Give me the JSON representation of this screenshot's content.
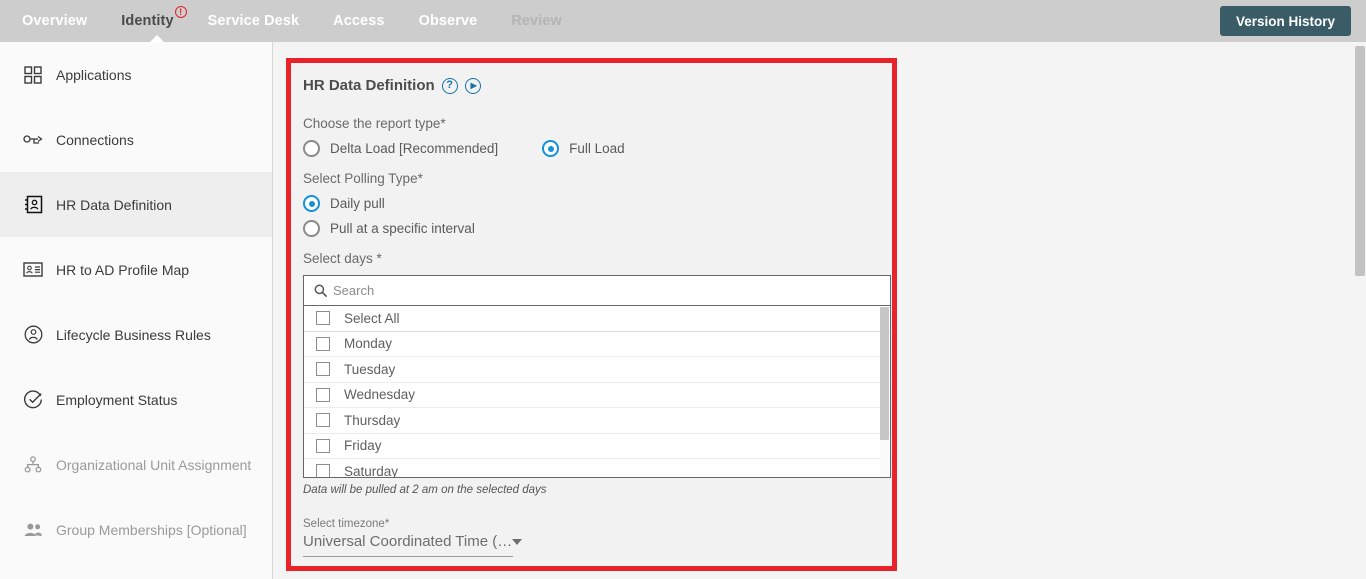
{
  "topnav": {
    "items": [
      {
        "label": "Overview",
        "state": "normal"
      },
      {
        "label": "Identity",
        "state": "active",
        "badge": "!"
      },
      {
        "label": "Service Desk",
        "state": "normal"
      },
      {
        "label": "Access",
        "state": "normal"
      },
      {
        "label": "Observe",
        "state": "normal"
      },
      {
        "label": "Review",
        "state": "muted"
      }
    ],
    "version_history_label": "Version History",
    "background_color": "#cdcdcd",
    "version_button_color": "#3a5c66",
    "badge_color": "#e8232a"
  },
  "sidebar": {
    "items": [
      {
        "label": "Applications",
        "icon": "grid-icon",
        "state": "normal"
      },
      {
        "label": "Connections",
        "icon": "connection-icon",
        "state": "normal"
      },
      {
        "label": "HR Data Definition",
        "icon": "contact-book-icon",
        "state": "active"
      },
      {
        "label": "HR to AD Profile Map",
        "icon": "id-card-icon",
        "state": "normal"
      },
      {
        "label": "Lifecycle Business Rules",
        "icon": "user-circle-icon",
        "state": "normal"
      },
      {
        "label": "Employment Status",
        "icon": "check-circle-icon",
        "state": "normal"
      },
      {
        "label": "Organizational Unit Assignment",
        "icon": "hierarchy-icon",
        "state": "disabled"
      },
      {
        "label": "Group Memberships [Optional]",
        "icon": "users-icon",
        "state": "disabled"
      }
    ]
  },
  "panel": {
    "highlight_color": "#e8232a",
    "title": "HR Data Definition",
    "help_icon": "?",
    "play_icon": "▶",
    "report_type": {
      "label": "Choose the report type*",
      "options": [
        {
          "label": "Delta Load [Recommended]",
          "selected": false
        },
        {
          "label": "Full Load",
          "selected": true
        }
      ]
    },
    "polling_type": {
      "label": "Select Polling Type*",
      "options": [
        {
          "label": "Daily pull",
          "selected": true
        },
        {
          "label": "Pull at a specific interval",
          "selected": false
        }
      ]
    },
    "select_days": {
      "label": "Select days *",
      "search_placeholder": "Search",
      "search_value": "",
      "items": [
        {
          "label": "Select All",
          "checked": false
        },
        {
          "label": "Monday",
          "checked": false
        },
        {
          "label": "Tuesday",
          "checked": false
        },
        {
          "label": "Wednesday",
          "checked": false
        },
        {
          "label": "Thursday",
          "checked": false
        },
        {
          "label": "Friday",
          "checked": false
        },
        {
          "label": "Saturday",
          "checked": false
        }
      ]
    },
    "hint": "Data will be pulled at 2 am on the selected days",
    "timezone": {
      "label": "Select timezone*",
      "value": "Universal Coordinated Time (…"
    },
    "accent_color": "#1591d8"
  }
}
